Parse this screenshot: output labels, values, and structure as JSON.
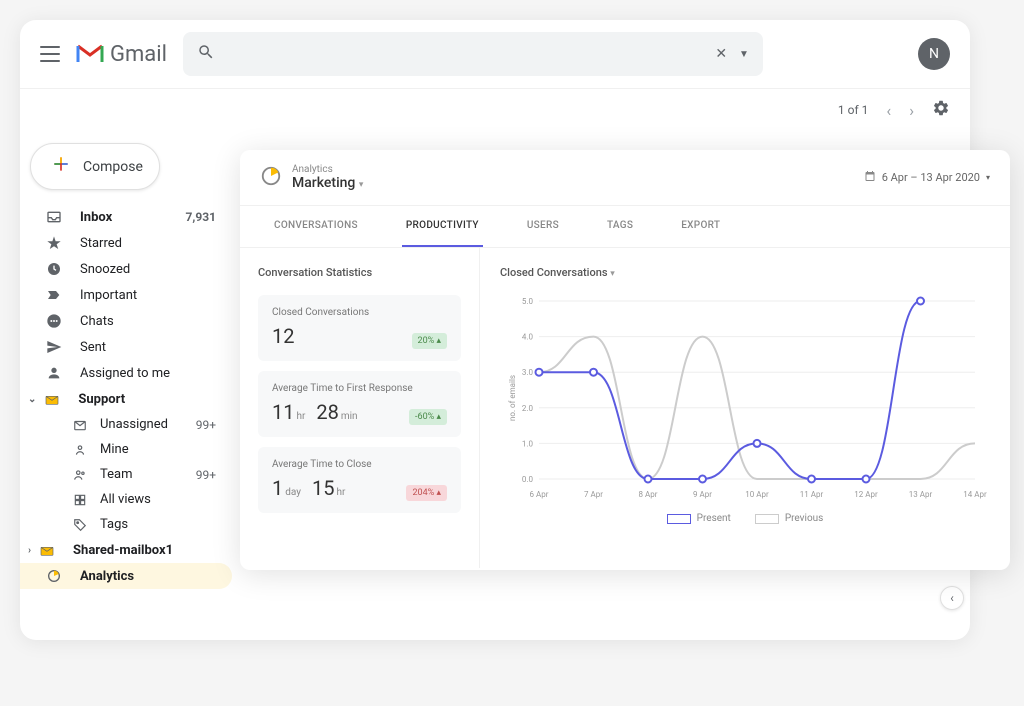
{
  "header": {
    "app_name": "Gmail",
    "avatar_initial": "N"
  },
  "toolbar": {
    "page_info": "1 of 1"
  },
  "compose": {
    "label": "Compose"
  },
  "sidebar": {
    "items": [
      {
        "label": "Inbox",
        "count": "7,931",
        "bold": true
      },
      {
        "label": "Starred"
      },
      {
        "label": "Snoozed"
      },
      {
        "label": "Important"
      },
      {
        "label": "Chats"
      },
      {
        "label": "Sent"
      },
      {
        "label": "Assigned to me"
      },
      {
        "label": "Support",
        "bold": true,
        "expanded": true
      },
      {
        "label": "Unassigned",
        "count": "99+",
        "nested": true
      },
      {
        "label": "Mine",
        "nested": true
      },
      {
        "label": "Team",
        "count": "99+",
        "nested": true
      },
      {
        "label": "All views",
        "nested": true
      },
      {
        "label": "Tags",
        "nested": true
      },
      {
        "label": "Shared-mailbox1",
        "bold": true
      },
      {
        "label": "Analytics",
        "bold": true,
        "active": true
      }
    ]
  },
  "analytics": {
    "breadcrumb": "Analytics",
    "section": "Marketing",
    "date_range": "6 Apr  –  13 Apr 2020",
    "tabs": [
      "CONVERSATIONS",
      "PRODUCTIVITY",
      "USERS",
      "TAGS",
      "EXPORT"
    ],
    "active_tab": "PRODUCTIVITY",
    "stats_title": "Conversation Statistics",
    "stats": [
      {
        "label": "Closed Conversations",
        "value_html": "12",
        "badge": "20%",
        "badge_dir": "▴",
        "badge_class": "green"
      },
      {
        "label": "Average Time to First Response",
        "value_parts": [
          {
            "n": "11",
            "u": "hr"
          },
          {
            "n": "28",
            "u": "min"
          }
        ],
        "badge": "-60%",
        "badge_dir": "▴",
        "badge_class": "green"
      },
      {
        "label": "Average Time to Close",
        "value_parts": [
          {
            "n": "1",
            "u": "day"
          },
          {
            "n": "15",
            "u": "hr"
          }
        ],
        "badge": "204%",
        "badge_dir": "▴",
        "badge_class": "red"
      }
    ],
    "chart_title": "Closed Conversations",
    "legend": {
      "present": "Present",
      "previous": "Previous"
    }
  },
  "chart_data": {
    "type": "line",
    "title": "Closed Conversations",
    "ylabel": "no. of emails",
    "ylim": [
      0,
      5
    ],
    "categories": [
      "6 Apr",
      "7 Apr",
      "8 Apr",
      "9 Apr",
      "10 Apr",
      "11 Apr",
      "12 Apr",
      "13 Apr",
      "14 Apr"
    ],
    "series": [
      {
        "name": "Present",
        "color": "#5b5be0",
        "values": [
          3.0,
          3.0,
          0.0,
          0.0,
          1.0,
          0.0,
          0.0,
          5.0,
          null
        ]
      },
      {
        "name": "Previous",
        "color": "#cccccc",
        "values": [
          3.0,
          4.0,
          0.0,
          4.0,
          0.0,
          0.0,
          0.0,
          0.0,
          1.0
        ]
      }
    ]
  }
}
